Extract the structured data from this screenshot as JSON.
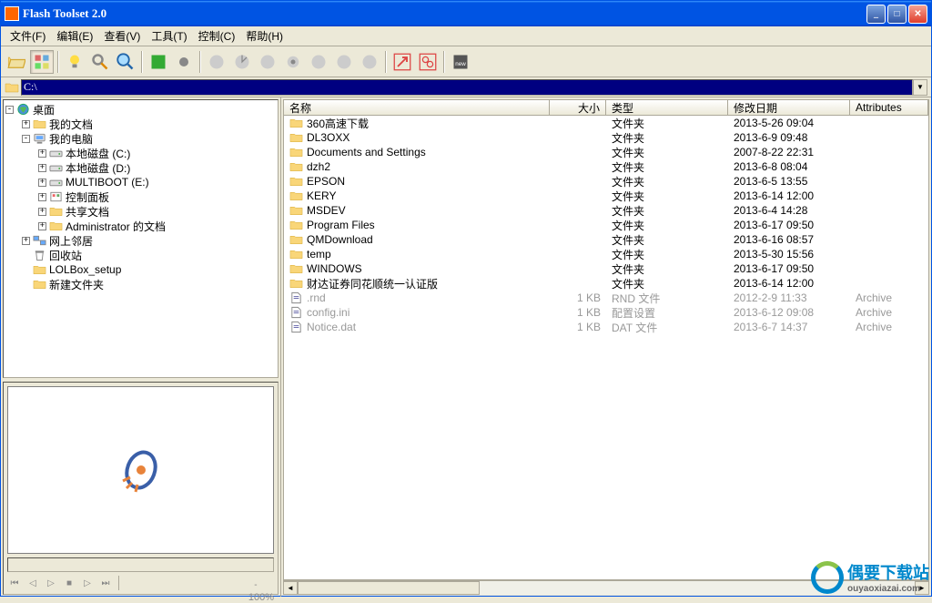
{
  "window": {
    "title": "Flash Toolset 2.0"
  },
  "menubar": [
    "文件(F)",
    "编辑(E)",
    "查看(V)",
    "工具(T)",
    "控制(C)",
    "帮助(H)"
  ],
  "path": {
    "value": "C:\\"
  },
  "tree": {
    "root": "桌面",
    "items": [
      {
        "indent": 0,
        "expand": "-",
        "icon": "desktop",
        "label": "桌面"
      },
      {
        "indent": 1,
        "expand": "+",
        "icon": "folder",
        "label": "我的文档"
      },
      {
        "indent": 1,
        "expand": "-",
        "icon": "computer",
        "label": "我的电脑"
      },
      {
        "indent": 2,
        "expand": "+",
        "icon": "drive",
        "label": "本地磁盘 (C:)"
      },
      {
        "indent": 2,
        "expand": "+",
        "icon": "drive",
        "label": "本地磁盘 (D:)"
      },
      {
        "indent": 2,
        "expand": "+",
        "icon": "drive",
        "label": "MULTIBOOT (E:)"
      },
      {
        "indent": 2,
        "expand": "+",
        "icon": "control",
        "label": "控制面板"
      },
      {
        "indent": 2,
        "expand": "+",
        "icon": "folder",
        "label": "共享文档"
      },
      {
        "indent": 2,
        "expand": "+",
        "icon": "folder",
        "label": "Administrator 的文档"
      },
      {
        "indent": 1,
        "expand": "+",
        "icon": "network",
        "label": "网上邻居"
      },
      {
        "indent": 1,
        "expand": "",
        "icon": "recycle",
        "label": "回收站"
      },
      {
        "indent": 1,
        "expand": "",
        "icon": "folder",
        "label": "LOLBox_setup"
      },
      {
        "indent": 1,
        "expand": "",
        "icon": "folder",
        "label": "新建文件夹"
      }
    ]
  },
  "columns": {
    "name": "名称",
    "size": "大小",
    "type": "类型",
    "date": "修改日期",
    "attr": "Attributes"
  },
  "files": [
    {
      "icon": "folder",
      "name": "360高速下载",
      "size": "",
      "type": "文件夹",
      "date": "2013-5-26 09:04",
      "attr": ""
    },
    {
      "icon": "folder",
      "name": "DL3OXX",
      "size": "",
      "type": "文件夹",
      "date": "2013-6-9 09:48",
      "attr": ""
    },
    {
      "icon": "folder",
      "name": "Documents and Settings",
      "size": "",
      "type": "文件夹",
      "date": "2007-8-22 22:31",
      "attr": ""
    },
    {
      "icon": "folder",
      "name": "dzh2",
      "size": "",
      "type": "文件夹",
      "date": "2013-6-8 08:04",
      "attr": ""
    },
    {
      "icon": "folder",
      "name": "EPSON",
      "size": "",
      "type": "文件夹",
      "date": "2013-6-5 13:55",
      "attr": ""
    },
    {
      "icon": "folder",
      "name": "KERY",
      "size": "",
      "type": "文件夹",
      "date": "2013-6-14 12:00",
      "attr": ""
    },
    {
      "icon": "folder",
      "name": "MSDEV",
      "size": "",
      "type": "文件夹",
      "date": "2013-6-4 14:28",
      "attr": ""
    },
    {
      "icon": "folder",
      "name": "Program Files",
      "size": "",
      "type": "文件夹",
      "date": "2013-6-17 09:50",
      "attr": ""
    },
    {
      "icon": "folder",
      "name": "QMDownload",
      "size": "",
      "type": "文件夹",
      "date": "2013-6-16 08:57",
      "attr": ""
    },
    {
      "icon": "folder",
      "name": "temp",
      "size": "",
      "type": "文件夹",
      "date": "2013-5-30 15:56",
      "attr": ""
    },
    {
      "icon": "folder",
      "name": "WINDOWS",
      "size": "",
      "type": "文件夹",
      "date": "2013-6-17 09:50",
      "attr": ""
    },
    {
      "icon": "folder",
      "name": "财达证券同花顺统一认证版",
      "size": "",
      "type": "文件夹",
      "date": "2013-6-14 12:00",
      "attr": ""
    },
    {
      "icon": "file",
      "name": ".rnd",
      "size": "1 KB",
      "type": "RND 文件",
      "date": "2012-2-9 11:33",
      "attr": "Archive",
      "dimmed": true
    },
    {
      "icon": "file",
      "name": "config.ini",
      "size": "1 KB",
      "type": "配置设置",
      "date": "2013-6-12 09:08",
      "attr": "Archive",
      "dimmed": true
    },
    {
      "icon": "file",
      "name": "Notice.dat",
      "size": "1 KB",
      "type": "DAT 文件",
      "date": "2013-6-7 14:37",
      "attr": "Archive",
      "dimmed": true
    }
  ],
  "preview": {
    "zoom": "100%",
    "plus": "+",
    "minus": "-"
  },
  "watermark": {
    "text": "偶要下载站",
    "url": "ouyaoxiazai.com"
  }
}
